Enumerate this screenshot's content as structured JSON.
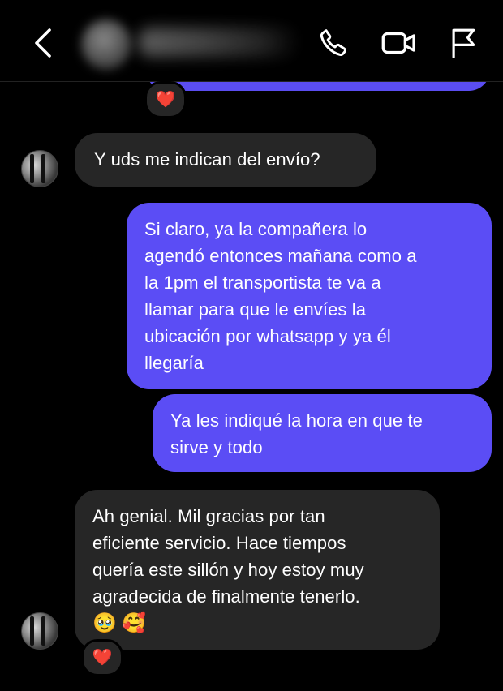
{
  "header": {
    "back_icon": "chevron-left-icon",
    "call_icon": "phone-icon",
    "video_icon": "video-camera-icon",
    "report_icon": "flag-icon"
  },
  "colors": {
    "background": "#000000",
    "incoming_bubble": "#262626",
    "outgoing_bubble": "#5b4df5",
    "heart": "#e0203a"
  },
  "messages": [
    {
      "direction": "incoming",
      "lines": [
        "Y uds me indican del envío?"
      ]
    },
    {
      "direction": "outgoing",
      "lines": [
        "Si claro, ya la compañera lo",
        "agendó entonces mañana como a",
        "la 1pm el transportista te va a",
        "llamar para que le envíes la",
        "ubicación por whatsapp y ya él",
        "llegaría"
      ]
    },
    {
      "direction": "outgoing",
      "lines": [
        "Ya les indiqué la hora en que te",
        "sirve y todo"
      ]
    },
    {
      "direction": "incoming",
      "lines": [
        "Ah genial. Mil gracias por tan",
        "eficiente servicio. Hace tiempos",
        "quería este sillón y hoy estoy muy",
        "agradecida de finalmente tenerlo."
      ],
      "emojis": [
        "🥹",
        "🥰"
      ]
    }
  ],
  "reactions": [
    "❤️",
    "❤️"
  ]
}
